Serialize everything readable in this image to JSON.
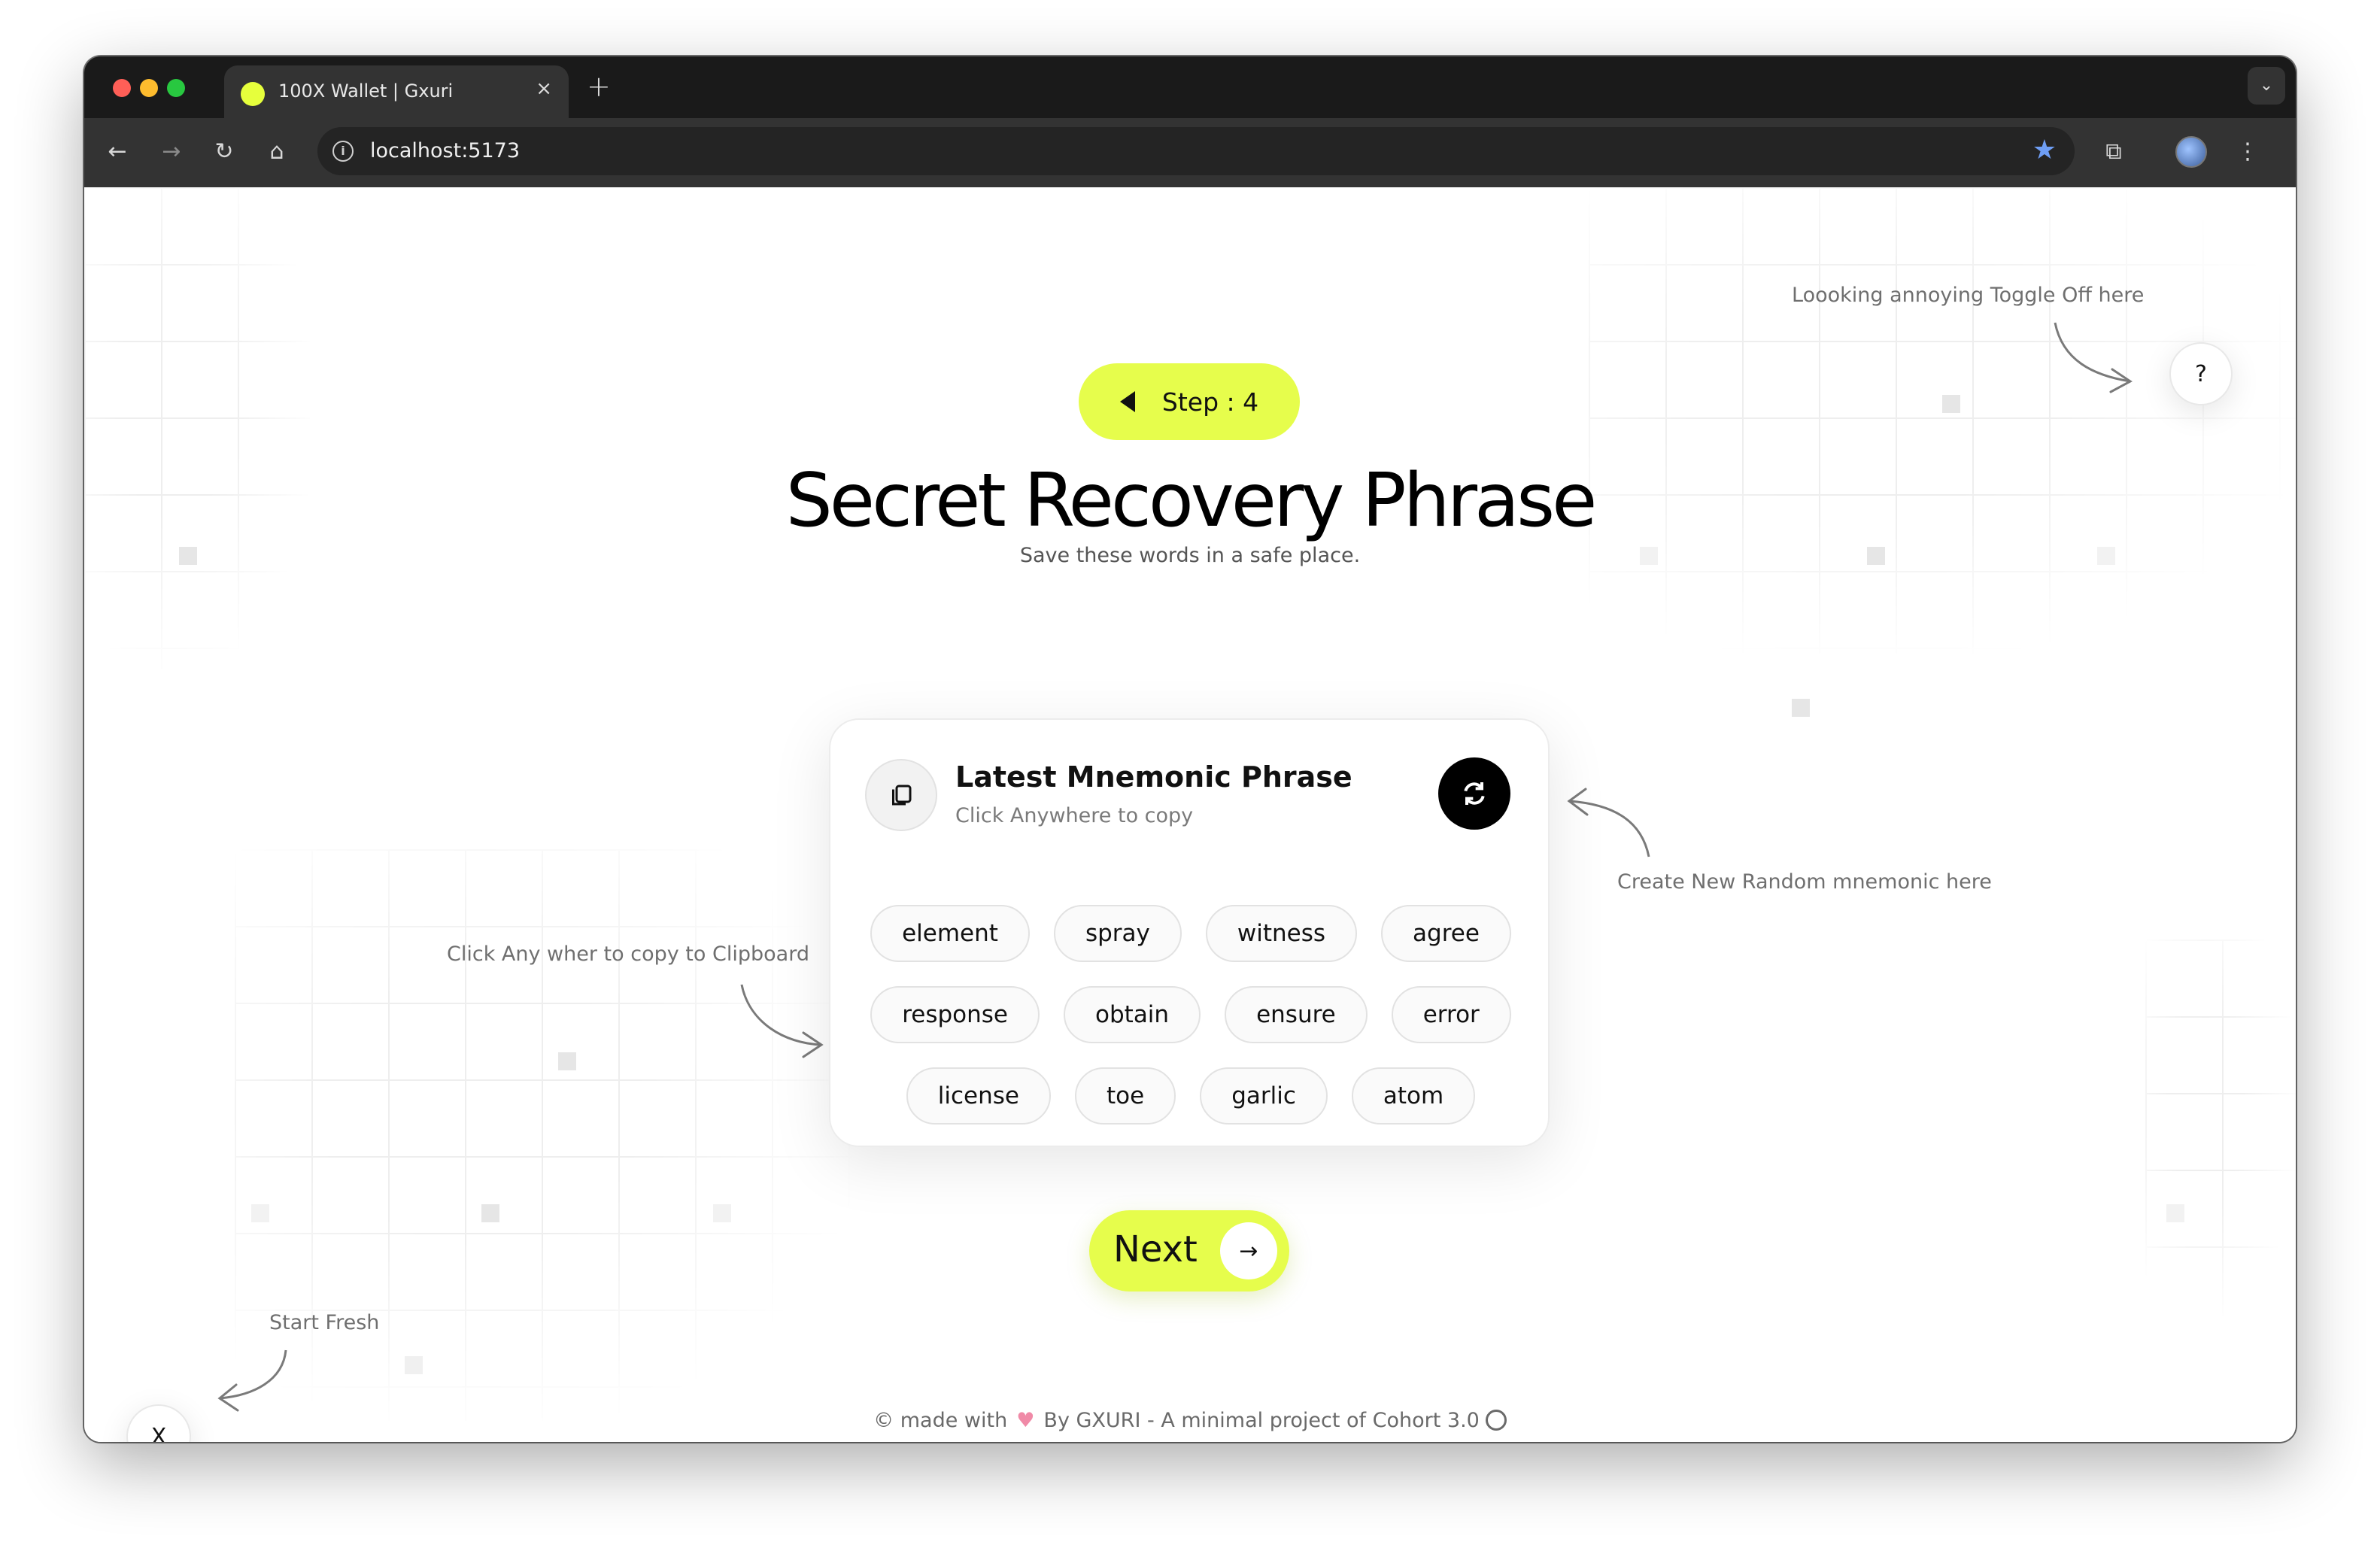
{
  "browser": {
    "tab_title": "100X Wallet | Gxuri",
    "tab_close": "×",
    "new_tab": "+",
    "tab_menu": "⌄",
    "url": "localhost:5173",
    "traffic_colors": [
      "#ff5f57",
      "#febc2e",
      "#28c840"
    ],
    "nav": {
      "back": "←",
      "forward": "→",
      "reload": "↻",
      "home": "⌂",
      "info": "i",
      "star": "★",
      "extensions": "⧉",
      "menu": "⋮"
    }
  },
  "page": {
    "help_hint": "Loooking annoying Toggle Off here",
    "help_label": "?",
    "step": {
      "label": "Step : 4"
    },
    "title": "Secret Recovery Phrase",
    "subtitle": "Save these words in a safe place.",
    "card": {
      "title": "Latest Mnemonic Phrase",
      "subtitle": "Click Anywhere to copy",
      "words": [
        [
          "element",
          "spray",
          "witness",
          "agree"
        ],
        [
          "response",
          "obtain",
          "ensure",
          "error"
        ],
        [
          "license",
          "toe",
          "garlic",
          "atom"
        ]
      ]
    },
    "refresh_hint": "Create New Random mnemonic here",
    "copy_hint": "Click Any wher to copy to Clipboard",
    "next_label": "Next",
    "next_arrow": "→",
    "start_fresh_hint": "Start Fresh",
    "close_label": "X",
    "footer": {
      "made_with": "© made with",
      "heart": "♥",
      "by": "By  GXURI  - A minimal project of Cohort 3.0"
    },
    "accent_color": "#e6fd4c"
  }
}
